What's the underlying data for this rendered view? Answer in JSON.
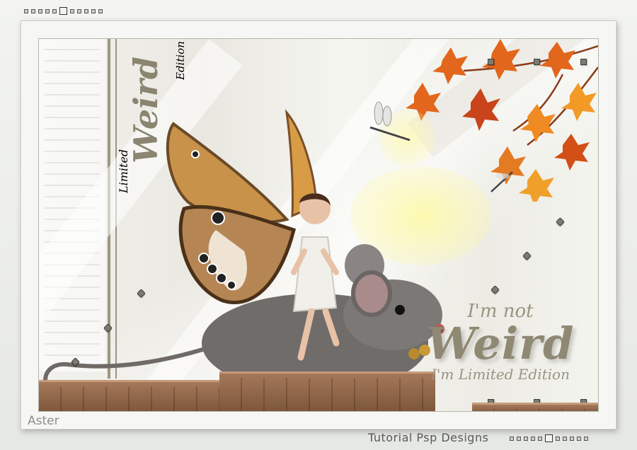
{
  "artwork": {
    "vertical_word_small_top": "Edition",
    "vertical_word_big": "Weird",
    "vertical_word_small_bottom": "Limited",
    "headline_line1": "I'm not",
    "headline_line2": "Weird",
    "headline_line3": "I'm Limited Edition"
  },
  "watermarks": {
    "artist": "Aster",
    "credit": "Tutorial  Psp Designs"
  },
  "colors": {
    "frame": "#f6f7f4",
    "text_taupe": "#8f8873",
    "leaf_orange": "#e0621a",
    "wood": "#8a5f40"
  },
  "icons": {
    "corner_dots": "square-dot-strip",
    "fairy": "fairy-figure",
    "mouse": "grey-mouse",
    "leaves": "autumn-maple-leaves",
    "dragonfly": "dragonfly"
  }
}
